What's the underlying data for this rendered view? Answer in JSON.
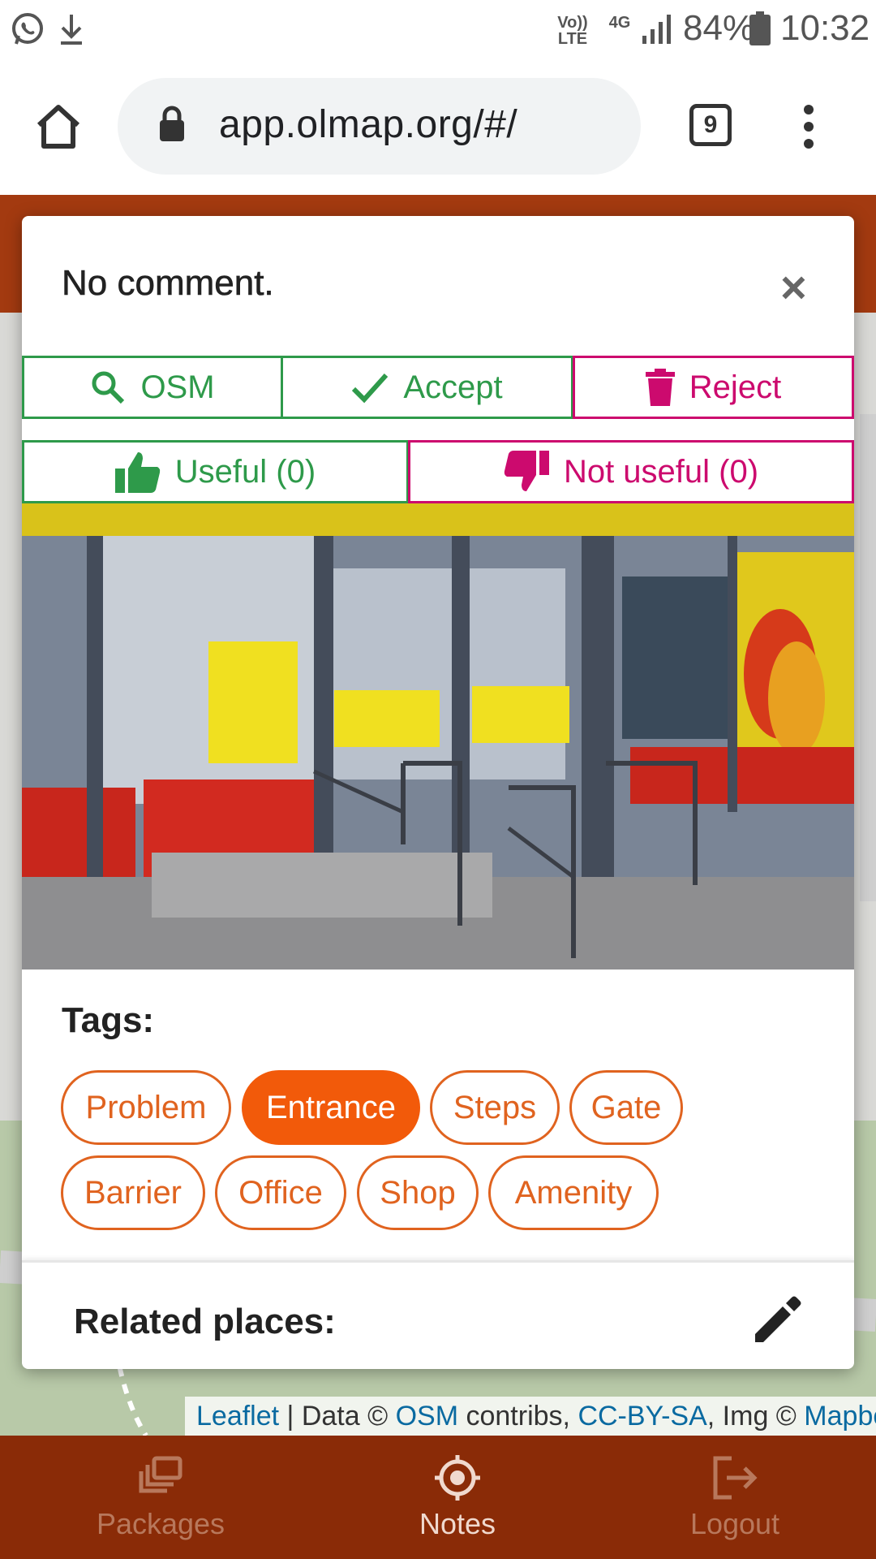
{
  "status_bar": {
    "volte_label_top": "Vo))",
    "volte_label_bottom": "LTE",
    "network_label": "4G",
    "battery": "84%",
    "time": "10:32",
    "icons": [
      "whatsapp-icon",
      "download-icon",
      "signal-icon",
      "battery-icon"
    ]
  },
  "browser": {
    "url": "app.olmap.org/#/",
    "tab_count": "9"
  },
  "modal": {
    "title": "No comment.",
    "close_label": "×",
    "buttons": {
      "osm": "OSM",
      "accept": "Accept",
      "reject": "Reject",
      "useful": "Useful (0)",
      "not_useful": "Not useful (0)"
    },
    "tags_heading": "Tags:",
    "tags": [
      {
        "label": "Problem",
        "selected": false
      },
      {
        "label": "Entrance",
        "selected": true
      },
      {
        "label": "Steps",
        "selected": false
      },
      {
        "label": "Gate",
        "selected": false
      },
      {
        "label": "Barrier",
        "selected": false
      },
      {
        "label": "Office",
        "selected": false
      },
      {
        "label": "Shop",
        "selected": false
      },
      {
        "label": "Amenity",
        "selected": false
      }
    ],
    "related_places_label": "Related places:"
  },
  "attribution": {
    "leaflet": "Leaflet",
    "sep": " | Data © ",
    "osm": "OSM",
    "contribs": " contribs, ",
    "license": "CC-BY-SA",
    "img": ", Img © ",
    "mapbox": "Mapbox"
  },
  "bottom_nav": {
    "packages": "Packages",
    "notes": "Notes",
    "logout": "Logout",
    "active": "notes"
  },
  "colors": {
    "brand": "#a33a10",
    "accept_green": "#2e9a4a",
    "reject_pink": "#cc0a6e",
    "tag_orange": "#e0631f",
    "tag_selected": "#f25a0a"
  }
}
